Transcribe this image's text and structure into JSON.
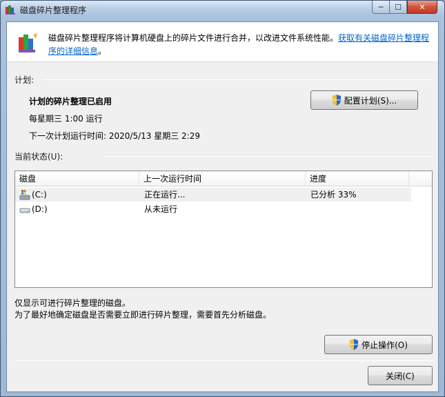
{
  "window": {
    "title": "磁盘碎片整理程序",
    "controls": {
      "minimize": "─",
      "maximize": "☐",
      "close": "✕"
    }
  },
  "header": {
    "description": "磁盘碎片整理程序将计算机硬盘上的碎片文件进行合并，以改进文件系统性能。",
    "link": "获取有关磁盘碎片整理程序的详细信息",
    "link_suffix": "。"
  },
  "schedule": {
    "section_label": "计划:",
    "status": "计划的碎片整理已启用",
    "frequency": "每星期三  1:00 运行",
    "next_run": "下一次计划运行时间: 2020/5/13 星期三 2:29",
    "configure_button": "配置计划(S)..."
  },
  "current_status": {
    "section_label": "当前状态(U):",
    "columns": [
      "磁盘",
      "上一次运行时间",
      "进度"
    ],
    "rows": [
      {
        "disk": "(C:)",
        "last_run": "正在运行...",
        "progress": "已分析 33%",
        "icon": "system-drive-icon",
        "selected": true
      },
      {
        "disk": "(D:)",
        "last_run": "从未运行",
        "progress": "",
        "icon": "drive-icon",
        "selected": false
      }
    ]
  },
  "notes": {
    "line1": "仅显示可进行碎片整理的磁盘。",
    "line2": "为了最好地确定磁盘是否需要立即进行碎片整理，需要首先分析磁盘。"
  },
  "actions": {
    "stop_button": "停止操作(O)",
    "close_button": "关闭(C)"
  },
  "colors": {
    "link": "#0066cc",
    "title_bar": "#bcd0e7",
    "close_button": "#c13b22"
  }
}
